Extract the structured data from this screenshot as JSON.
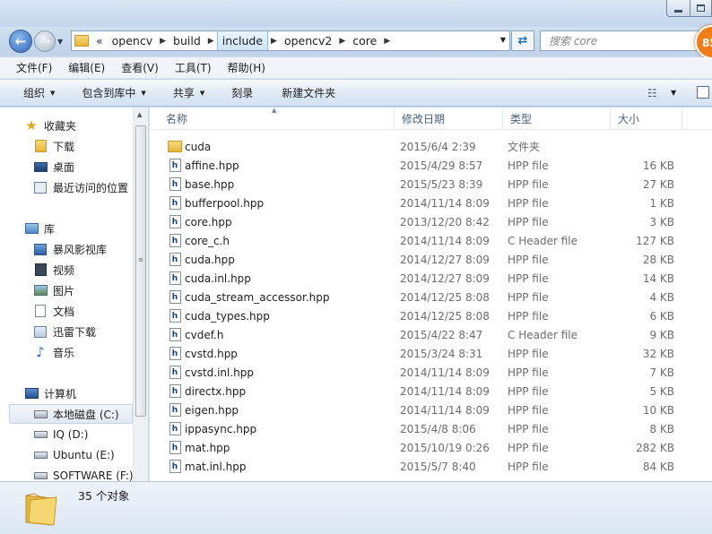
{
  "window": {
    "minimize_icon": "minimize-icon",
    "maximize_icon": "maximize-icon"
  },
  "navigation": {
    "back_icon": "back-arrow-icon",
    "forward_icon": "forward-arrow-icon",
    "breadcrumbs": [
      "opencv",
      "build",
      "include",
      "opencv2",
      "core"
    ],
    "overflow_label": "«",
    "search_placeholder": "搜索 core",
    "badge_value": "85"
  },
  "menu": [
    "文件(F)",
    "编辑(E)",
    "查看(V)",
    "工具(T)",
    "帮助(H)"
  ],
  "commands": {
    "organize": "组织",
    "include_in_library": "包含到库中",
    "share": "共享",
    "burn": "刻录",
    "new_folder": "新建文件夹"
  },
  "sidebar": {
    "favorites": {
      "title": "收藏夹",
      "items": [
        "下载",
        "桌面",
        "最近访问的位置"
      ]
    },
    "libraries": {
      "title": "库",
      "items": [
        "暴风影视库",
        "视频",
        "图片",
        "文档",
        "迅雷下载",
        "音乐"
      ]
    },
    "computer": {
      "title": "计算机",
      "items": [
        "本地磁盘 (C:)",
        "IQ (D:)",
        "Ubuntu (E:)",
        "SOFTWARE (F:)"
      ]
    }
  },
  "columns": {
    "name": "名称",
    "date": "修改日期",
    "type": "类型",
    "size": "大小"
  },
  "files": [
    {
      "name": "cuda",
      "date": "2015/6/4 2:39",
      "type": "文件夹",
      "size": "",
      "is_folder": true
    },
    {
      "name": "affine.hpp",
      "date": "2015/4/29 8:57",
      "type": "HPP file",
      "size": "16 KB"
    },
    {
      "name": "base.hpp",
      "date": "2015/5/23 8:39",
      "type": "HPP file",
      "size": "27 KB"
    },
    {
      "name": "bufferpool.hpp",
      "date": "2014/11/14 8:09",
      "type": "HPP file",
      "size": "1 KB"
    },
    {
      "name": "core.hpp",
      "date": "2013/12/20 8:42",
      "type": "HPP file",
      "size": "3 KB"
    },
    {
      "name": "core_c.h",
      "date": "2014/11/14 8:09",
      "type": "C Header file",
      "size": "127 KB"
    },
    {
      "name": "cuda.hpp",
      "date": "2014/12/27 8:09",
      "type": "HPP file",
      "size": "28 KB"
    },
    {
      "name": "cuda.inl.hpp",
      "date": "2014/12/27 8:09",
      "type": "HPP file",
      "size": "14 KB"
    },
    {
      "name": "cuda_stream_accessor.hpp",
      "date": "2014/12/25 8:08",
      "type": "HPP file",
      "size": "4 KB"
    },
    {
      "name": "cuda_types.hpp",
      "date": "2014/12/25 8:08",
      "type": "HPP file",
      "size": "6 KB"
    },
    {
      "name": "cvdef.h",
      "date": "2015/4/22 8:47",
      "type": "C Header file",
      "size": "9 KB"
    },
    {
      "name": "cvstd.hpp",
      "date": "2015/3/24 8:31",
      "type": "HPP file",
      "size": "32 KB"
    },
    {
      "name": "cvstd.inl.hpp",
      "date": "2014/11/14 8:09",
      "type": "HPP file",
      "size": "7 KB"
    },
    {
      "name": "directx.hpp",
      "date": "2014/11/14 8:09",
      "type": "HPP file",
      "size": "5 KB"
    },
    {
      "name": "eigen.hpp",
      "date": "2014/11/14 8:09",
      "type": "HPP file",
      "size": "10 KB"
    },
    {
      "name": "ippasync.hpp",
      "date": "2015/4/8 8:06",
      "type": "HPP file",
      "size": "8 KB"
    },
    {
      "name": "mat.hpp",
      "date": "2015/10/19 0:26",
      "type": "HPP file",
      "size": "282 KB"
    },
    {
      "name": "mat.inl.hpp",
      "date": "2015/5/7 8:40",
      "type": "HPP file",
      "size": "84 KB"
    }
  ],
  "status": {
    "item_count": "35 个对象"
  }
}
